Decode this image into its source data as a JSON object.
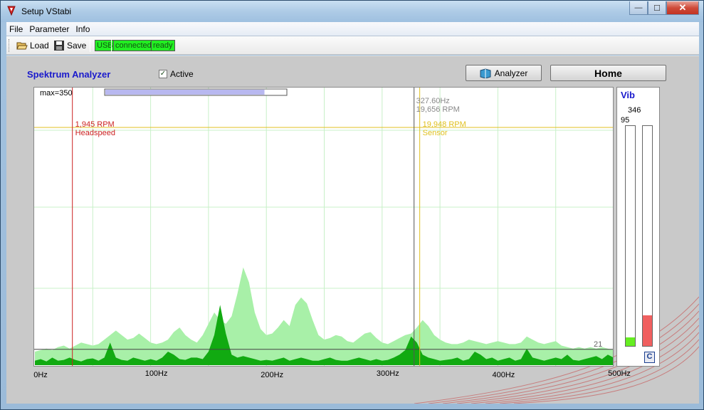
{
  "window": {
    "title": "Setup VStabi",
    "controls": {
      "minimize": "—",
      "maximize": "☐",
      "close": "✕"
    }
  },
  "menu": [
    "File",
    "Parameter",
    "Info"
  ],
  "toolbar": {
    "load_label": "Load",
    "save_label": "Save",
    "usb_label": "USB",
    "connected_label": "connected",
    "ready_label": "ready"
  },
  "panel": {
    "title": "Spektrum Analyzer",
    "active_label": "Active",
    "active_checked": true,
    "analyzer_button": "Analyzer",
    "home_button": "Home"
  },
  "spectrum": {
    "max_label": "max=350",
    "scroll_fraction": 0.88,
    "cursor": {
      "freq_label": "327.60Hz",
      "rpm_label": "19,656 RPM"
    },
    "headspeed": {
      "rpm_label": "1,945 RPM",
      "name": "Headspeed",
      "color": "#cc2222"
    },
    "sensor": {
      "rpm_label": "19,948 RPM",
      "name": "Sensor",
      "color": "#e0c020"
    },
    "threshold_label": "21",
    "x_ticks": [
      "0Hz",
      "100Hz",
      "200Hz",
      "300Hz",
      "400Hz",
      "500Hz"
    ]
  },
  "chart_data": {
    "type": "area",
    "x_unit": "Hz",
    "xlim": [
      0,
      500
    ],
    "ylim": [
      0,
      350
    ],
    "grid": true,
    "headspeed_hz": 32.4,
    "sensor_hz": 332.5,
    "cursor_hz": 327.6,
    "threshold_value": 21,
    "series": [
      {
        "name": "",
        "color": "#a8f0a8",
        "x": [
          0,
          5,
          10,
          15,
          20,
          25,
          30,
          35,
          40,
          45,
          50,
          55,
          60,
          65,
          70,
          75,
          80,
          85,
          90,
          95,
          100,
          105,
          110,
          115,
          120,
          125,
          130,
          135,
          140,
          145,
          150,
          155,
          160,
          165,
          170,
          175,
          180,
          185,
          190,
          195,
          200,
          205,
          210,
          215,
          220,
          225,
          230,
          235,
          240,
          245,
          250,
          255,
          260,
          265,
          270,
          275,
          280,
          285,
          290,
          295,
          300,
          305,
          310,
          315,
          320,
          325,
          330,
          335,
          340,
          345,
          350,
          355,
          360,
          365,
          370,
          375,
          380,
          385,
          390,
          395,
          400,
          405,
          410,
          415,
          420,
          425,
          430,
          435,
          440,
          445,
          450,
          455,
          460,
          465,
          470,
          475,
          480,
          485,
          490,
          495,
          500
        ],
        "values": [
          18,
          20,
          22,
          20,
          24,
          26,
          22,
          26,
          30,
          28,
          26,
          28,
          34,
          40,
          46,
          40,
          34,
          36,
          42,
          36,
          30,
          28,
          30,
          34,
          44,
          50,
          40,
          34,
          30,
          40,
          55,
          70,
          60,
          55,
          65,
          95,
          130,
          110,
          70,
          48,
          40,
          42,
          50,
          60,
          52,
          80,
          90,
          82,
          60,
          40,
          34,
          36,
          40,
          38,
          32,
          30,
          36,
          42,
          44,
          36,
          30,
          28,
          32,
          36,
          40,
          42,
          50,
          60,
          52,
          40,
          34,
          30,
          28,
          28,
          30,
          34,
          32,
          30,
          28,
          30,
          32,
          30,
          28,
          28,
          30,
          38,
          34,
          30,
          28,
          30,
          32,
          26,
          24,
          22,
          24,
          22,
          24,
          22,
          24,
          22,
          20
        ]
      },
      {
        "name": "",
        "color": "#11aa11",
        "x": [
          0,
          5,
          10,
          15,
          20,
          25,
          30,
          35,
          40,
          45,
          50,
          55,
          60,
          65,
          70,
          75,
          80,
          85,
          90,
          95,
          100,
          105,
          110,
          115,
          120,
          125,
          130,
          135,
          140,
          145,
          150,
          155,
          160,
          165,
          170,
          175,
          180,
          185,
          190,
          195,
          200,
          205,
          210,
          215,
          220,
          225,
          230,
          235,
          240,
          245,
          250,
          255,
          260,
          265,
          270,
          275,
          280,
          285,
          290,
          295,
          300,
          305,
          310,
          315,
          320,
          325,
          330,
          335,
          340,
          345,
          350,
          355,
          360,
          365,
          370,
          375,
          380,
          385,
          390,
          395,
          400,
          405,
          410,
          415,
          420,
          425,
          430,
          435,
          440,
          445,
          450,
          455,
          460,
          465,
          470,
          475,
          480,
          485,
          490,
          495,
          500
        ],
        "values": [
          6,
          8,
          5,
          10,
          6,
          7,
          10,
          7,
          5,
          8,
          9,
          6,
          10,
          30,
          10,
          7,
          6,
          10,
          8,
          6,
          8,
          6,
          10,
          18,
          14,
          8,
          7,
          10,
          10,
          8,
          18,
          40,
          80,
          42,
          14,
          10,
          12,
          10,
          8,
          6,
          7,
          6,
          8,
          10,
          6,
          8,
          10,
          8,
          6,
          6,
          8,
          10,
          7,
          6,
          6,
          8,
          10,
          8,
          6,
          8,
          6,
          7,
          10,
          14,
          20,
          38,
          30,
          14,
          10,
          8,
          6,
          7,
          8,
          10,
          6,
          8,
          18,
          14,
          8,
          10,
          6,
          8,
          10,
          6,
          8,
          22,
          10,
          8,
          6,
          8,
          10,
          8,
          14,
          7,
          6,
          8,
          10,
          12,
          8,
          14,
          10
        ]
      }
    ]
  },
  "vib": {
    "title": "Vib",
    "value_left": "95",
    "value_right": "346",
    "bar_left_fraction": 0.04,
    "bar_right_fraction": 0.14,
    "bar_left_color": "#66ee22",
    "bar_right_color": "#f06060",
    "reset_label": "C"
  }
}
